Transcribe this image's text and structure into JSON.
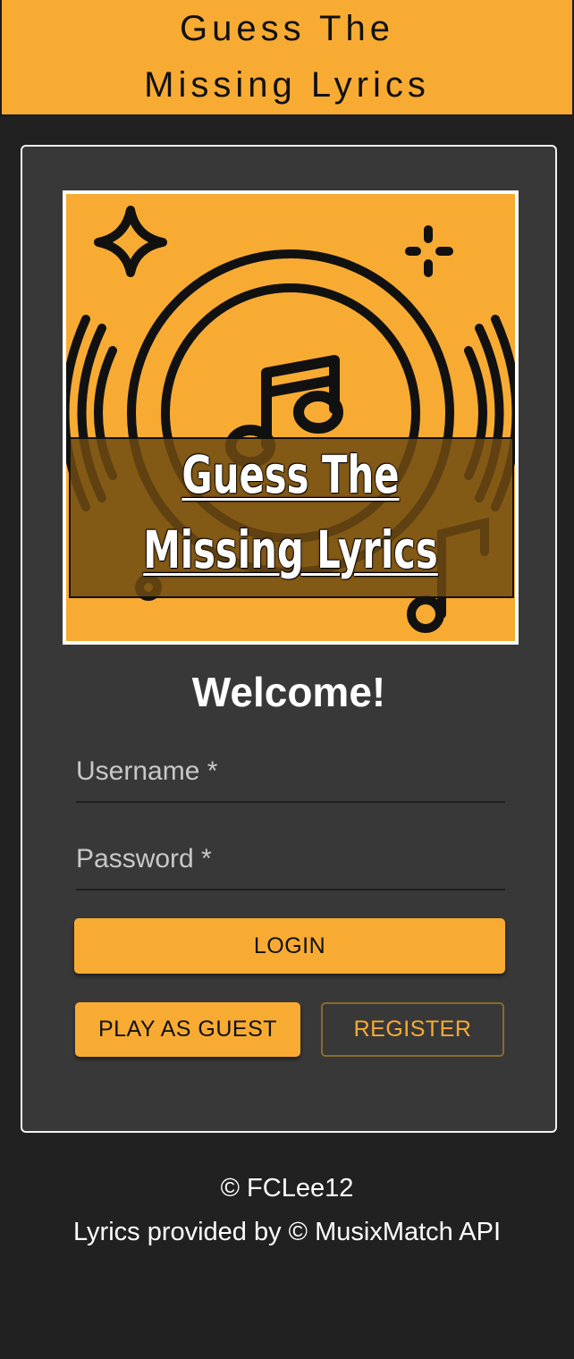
{
  "header": {
    "title_line1": "Guess The",
    "title_line2": "Missing Lyrics"
  },
  "logo": {
    "title_line1": "Guess The",
    "title_line2": "Missing Lyrics",
    "icon": "music-note-disc-icon",
    "background": "#f8ab33"
  },
  "login_form": {
    "heading": "Welcome!",
    "username_label": "Username *",
    "password_label": "Password *",
    "login_button": "LOGIN",
    "guest_button": "PLAY AS GUEST",
    "register_button": "REGISTER"
  },
  "footer": {
    "copyright": "© FCLee12",
    "attribution": "Lyrics provided by © MusixMatch API"
  },
  "colors": {
    "accent": "#f8ab33",
    "background": "#212121",
    "card": "#383838"
  }
}
